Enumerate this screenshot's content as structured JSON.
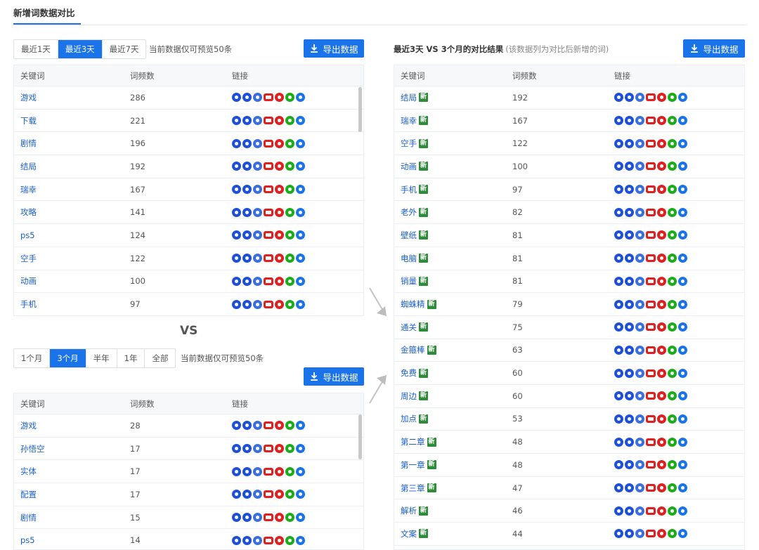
{
  "page_title": "新增词数据对比",
  "vs_label": "VS",
  "export_label": "导出数据",
  "icons": [
    "paw-icon",
    "toutiao-icon",
    "sogou-icon",
    "video-icon",
    "weibo-icon",
    "wechat-icon",
    "zhihu-icon"
  ],
  "top_panel": {
    "filters": [
      {
        "label": "最近1天",
        "active": false
      },
      {
        "label": "最近3天",
        "active": true
      },
      {
        "label": "最近7天",
        "active": false
      }
    ],
    "hint": "当前数据仅可预览50条",
    "headers": {
      "keyword": "关键词",
      "count": "词频数",
      "links": "链接"
    },
    "rows": [
      {
        "keyword": "游戏",
        "count": "286"
      },
      {
        "keyword": "下载",
        "count": "221"
      },
      {
        "keyword": "剧情",
        "count": "196"
      },
      {
        "keyword": "结局",
        "count": "192"
      },
      {
        "keyword": "瑞幸",
        "count": "167"
      },
      {
        "keyword": "攻略",
        "count": "141"
      },
      {
        "keyword": "ps5",
        "count": "124"
      },
      {
        "keyword": "空手",
        "count": "122"
      },
      {
        "keyword": "动画",
        "count": "100"
      },
      {
        "keyword": "手机",
        "count": "97"
      }
    ]
  },
  "bottom_panel": {
    "filters": [
      {
        "label": "1个月",
        "active": false
      },
      {
        "label": "3个月",
        "active": true
      },
      {
        "label": "半年",
        "active": false
      },
      {
        "label": "1年",
        "active": false
      },
      {
        "label": "全部",
        "active": false
      }
    ],
    "hint": "当前数据仅可预览50条",
    "headers": {
      "keyword": "关键词",
      "count": "词频数",
      "links": "链接"
    },
    "rows": [
      {
        "keyword": "游戏",
        "count": "28"
      },
      {
        "keyword": "孙悟空",
        "count": "17"
      },
      {
        "keyword": "实体",
        "count": "17"
      },
      {
        "keyword": "配置",
        "count": "17"
      },
      {
        "keyword": "剧情",
        "count": "15"
      },
      {
        "keyword": "ps5",
        "count": "14"
      }
    ]
  },
  "right_panel": {
    "title": "最近3天 VS 3个月的对比结果",
    "note": "(该数据列为对比后新增的词)",
    "new_badge": "新",
    "headers": {
      "keyword": "关键词",
      "count": "词频数",
      "links": "链接"
    },
    "rows": [
      {
        "keyword": "结局",
        "count": "192"
      },
      {
        "keyword": "瑞幸",
        "count": "167"
      },
      {
        "keyword": "空手",
        "count": "122"
      },
      {
        "keyword": "动画",
        "count": "100"
      },
      {
        "keyword": "手机",
        "count": "97"
      },
      {
        "keyword": "老外",
        "count": "82"
      },
      {
        "keyword": "壁纸",
        "count": "81"
      },
      {
        "keyword": "电脑",
        "count": "81"
      },
      {
        "keyword": "销量",
        "count": "81"
      },
      {
        "keyword": "蜘蛛精",
        "count": "79"
      },
      {
        "keyword": "通关",
        "count": "75"
      },
      {
        "keyword": "金箍棒",
        "count": "63"
      },
      {
        "keyword": "免费",
        "count": "60"
      },
      {
        "keyword": "周边",
        "count": "60"
      },
      {
        "keyword": "加点",
        "count": "53"
      },
      {
        "keyword": "第二章",
        "count": "48"
      },
      {
        "keyword": "第一章",
        "count": "48"
      },
      {
        "keyword": "第三章",
        "count": "47"
      },
      {
        "keyword": "解析",
        "count": "46"
      },
      {
        "keyword": "文案",
        "count": "44"
      }
    ]
  },
  "colors": {
    "accent": "#1a73e8",
    "new_badge": "#2e8b3a",
    "link_text": "#1a5fcf"
  }
}
